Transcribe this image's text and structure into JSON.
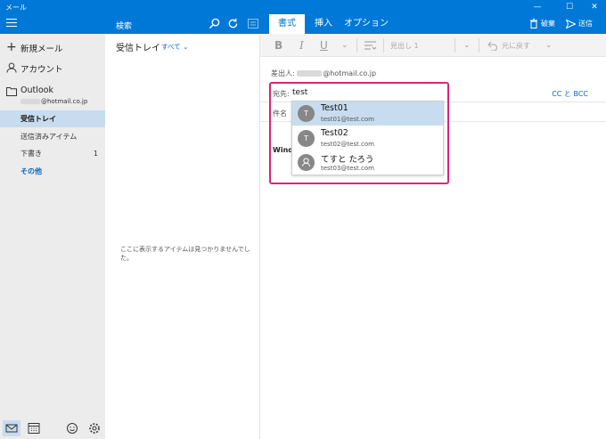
{
  "window": {
    "title": "メール",
    "controls": [
      "minimize-icon",
      "maximize-icon",
      "close-icon"
    ]
  },
  "toolbar": {
    "search_label": "検索",
    "tabs": [
      {
        "label": "書式",
        "active": true
      },
      {
        "label": "挿入",
        "active": false
      },
      {
        "label": "オプション",
        "active": false
      }
    ],
    "discard_label": "破棄",
    "send_label": "送信"
  },
  "sidebar": {
    "new_mail_label": "新規メール",
    "account_label": "アカウント",
    "account_name": "Outlook",
    "account_email": "@hotmail.co.jp",
    "folders": [
      {
        "label": "受信トレイ",
        "selected": true,
        "count": ""
      },
      {
        "label": "送信済みアイテム",
        "selected": false,
        "count": ""
      },
      {
        "label": "下書き",
        "selected": false,
        "count": "1"
      },
      {
        "label": "その他",
        "selected": false,
        "count": ""
      }
    ],
    "bottom_icons": [
      "mail-icon",
      "calendar-icon",
      "smiley-icon",
      "gear-icon"
    ]
  },
  "list": {
    "title": "受信トレイ",
    "filter_label": "すべて",
    "empty_message": "ここに表示するアイテムは見つかりませんでした。"
  },
  "format_bar": {
    "bold": "B",
    "italic": "I",
    "underline": "U",
    "heading_label": "見出し 1",
    "undo_label": "元に戻す"
  },
  "compose": {
    "from_label": "差出人:",
    "from_email": "@hotmail.co.jp",
    "to_label": "宛先:",
    "to_value": "test",
    "cc_bcc_label": "CC と BCC",
    "subject_label": "件名",
    "body_text": "Windo"
  },
  "suggestions": [
    {
      "initial": "T",
      "name": "Test01",
      "email": "test01@test.com",
      "selected": true
    },
    {
      "initial": "T",
      "name": "Test02",
      "email": "test02@test.com",
      "selected": false
    },
    {
      "initial": "",
      "name": "てすと たろう",
      "email": "test03@test.com",
      "selected": false
    }
  ],
  "colors": {
    "accent": "#0078d7",
    "selection": "#c7dcef",
    "highlight_border": "#d8257c",
    "link": "#0066cc"
  }
}
